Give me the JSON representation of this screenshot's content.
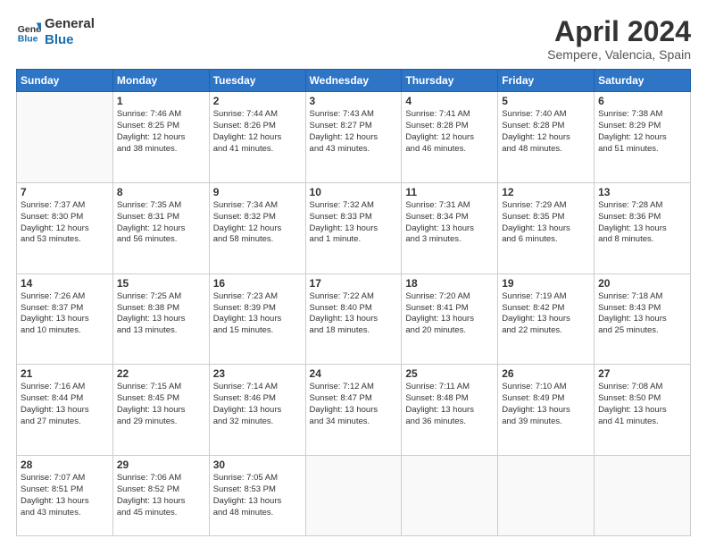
{
  "header": {
    "logo_general": "General",
    "logo_blue": "Blue",
    "month_title": "April 2024",
    "location": "Sempere, Valencia, Spain"
  },
  "days_of_week": [
    "Sunday",
    "Monday",
    "Tuesday",
    "Wednesday",
    "Thursday",
    "Friday",
    "Saturday"
  ],
  "weeks": [
    [
      {
        "day": "",
        "lines": []
      },
      {
        "day": "1",
        "lines": [
          "Sunrise: 7:46 AM",
          "Sunset: 8:25 PM",
          "Daylight: 12 hours",
          "and 38 minutes."
        ]
      },
      {
        "day": "2",
        "lines": [
          "Sunrise: 7:44 AM",
          "Sunset: 8:26 PM",
          "Daylight: 12 hours",
          "and 41 minutes."
        ]
      },
      {
        "day": "3",
        "lines": [
          "Sunrise: 7:43 AM",
          "Sunset: 8:27 PM",
          "Daylight: 12 hours",
          "and 43 minutes."
        ]
      },
      {
        "day": "4",
        "lines": [
          "Sunrise: 7:41 AM",
          "Sunset: 8:28 PM",
          "Daylight: 12 hours",
          "and 46 minutes."
        ]
      },
      {
        "day": "5",
        "lines": [
          "Sunrise: 7:40 AM",
          "Sunset: 8:28 PM",
          "Daylight: 12 hours",
          "and 48 minutes."
        ]
      },
      {
        "day": "6",
        "lines": [
          "Sunrise: 7:38 AM",
          "Sunset: 8:29 PM",
          "Daylight: 12 hours",
          "and 51 minutes."
        ]
      }
    ],
    [
      {
        "day": "7",
        "lines": [
          "Sunrise: 7:37 AM",
          "Sunset: 8:30 PM",
          "Daylight: 12 hours",
          "and 53 minutes."
        ]
      },
      {
        "day": "8",
        "lines": [
          "Sunrise: 7:35 AM",
          "Sunset: 8:31 PM",
          "Daylight: 12 hours",
          "and 56 minutes."
        ]
      },
      {
        "day": "9",
        "lines": [
          "Sunrise: 7:34 AM",
          "Sunset: 8:32 PM",
          "Daylight: 12 hours",
          "and 58 minutes."
        ]
      },
      {
        "day": "10",
        "lines": [
          "Sunrise: 7:32 AM",
          "Sunset: 8:33 PM",
          "Daylight: 13 hours",
          "and 1 minute."
        ]
      },
      {
        "day": "11",
        "lines": [
          "Sunrise: 7:31 AM",
          "Sunset: 8:34 PM",
          "Daylight: 13 hours",
          "and 3 minutes."
        ]
      },
      {
        "day": "12",
        "lines": [
          "Sunrise: 7:29 AM",
          "Sunset: 8:35 PM",
          "Daylight: 13 hours",
          "and 6 minutes."
        ]
      },
      {
        "day": "13",
        "lines": [
          "Sunrise: 7:28 AM",
          "Sunset: 8:36 PM",
          "Daylight: 13 hours",
          "and 8 minutes."
        ]
      }
    ],
    [
      {
        "day": "14",
        "lines": [
          "Sunrise: 7:26 AM",
          "Sunset: 8:37 PM",
          "Daylight: 13 hours",
          "and 10 minutes."
        ]
      },
      {
        "day": "15",
        "lines": [
          "Sunrise: 7:25 AM",
          "Sunset: 8:38 PM",
          "Daylight: 13 hours",
          "and 13 minutes."
        ]
      },
      {
        "day": "16",
        "lines": [
          "Sunrise: 7:23 AM",
          "Sunset: 8:39 PM",
          "Daylight: 13 hours",
          "and 15 minutes."
        ]
      },
      {
        "day": "17",
        "lines": [
          "Sunrise: 7:22 AM",
          "Sunset: 8:40 PM",
          "Daylight: 13 hours",
          "and 18 minutes."
        ]
      },
      {
        "day": "18",
        "lines": [
          "Sunrise: 7:20 AM",
          "Sunset: 8:41 PM",
          "Daylight: 13 hours",
          "and 20 minutes."
        ]
      },
      {
        "day": "19",
        "lines": [
          "Sunrise: 7:19 AM",
          "Sunset: 8:42 PM",
          "Daylight: 13 hours",
          "and 22 minutes."
        ]
      },
      {
        "day": "20",
        "lines": [
          "Sunrise: 7:18 AM",
          "Sunset: 8:43 PM",
          "Daylight: 13 hours",
          "and 25 minutes."
        ]
      }
    ],
    [
      {
        "day": "21",
        "lines": [
          "Sunrise: 7:16 AM",
          "Sunset: 8:44 PM",
          "Daylight: 13 hours",
          "and 27 minutes."
        ]
      },
      {
        "day": "22",
        "lines": [
          "Sunrise: 7:15 AM",
          "Sunset: 8:45 PM",
          "Daylight: 13 hours",
          "and 29 minutes."
        ]
      },
      {
        "day": "23",
        "lines": [
          "Sunrise: 7:14 AM",
          "Sunset: 8:46 PM",
          "Daylight: 13 hours",
          "and 32 minutes."
        ]
      },
      {
        "day": "24",
        "lines": [
          "Sunrise: 7:12 AM",
          "Sunset: 8:47 PM",
          "Daylight: 13 hours",
          "and 34 minutes."
        ]
      },
      {
        "day": "25",
        "lines": [
          "Sunrise: 7:11 AM",
          "Sunset: 8:48 PM",
          "Daylight: 13 hours",
          "and 36 minutes."
        ]
      },
      {
        "day": "26",
        "lines": [
          "Sunrise: 7:10 AM",
          "Sunset: 8:49 PM",
          "Daylight: 13 hours",
          "and 39 minutes."
        ]
      },
      {
        "day": "27",
        "lines": [
          "Sunrise: 7:08 AM",
          "Sunset: 8:50 PM",
          "Daylight: 13 hours",
          "and 41 minutes."
        ]
      }
    ],
    [
      {
        "day": "28",
        "lines": [
          "Sunrise: 7:07 AM",
          "Sunset: 8:51 PM",
          "Daylight: 13 hours",
          "and 43 minutes."
        ]
      },
      {
        "day": "29",
        "lines": [
          "Sunrise: 7:06 AM",
          "Sunset: 8:52 PM",
          "Daylight: 13 hours",
          "and 45 minutes."
        ]
      },
      {
        "day": "30",
        "lines": [
          "Sunrise: 7:05 AM",
          "Sunset: 8:53 PM",
          "Daylight: 13 hours",
          "and 48 minutes."
        ]
      },
      {
        "day": "",
        "lines": []
      },
      {
        "day": "",
        "lines": []
      },
      {
        "day": "",
        "lines": []
      },
      {
        "day": "",
        "lines": []
      }
    ]
  ]
}
